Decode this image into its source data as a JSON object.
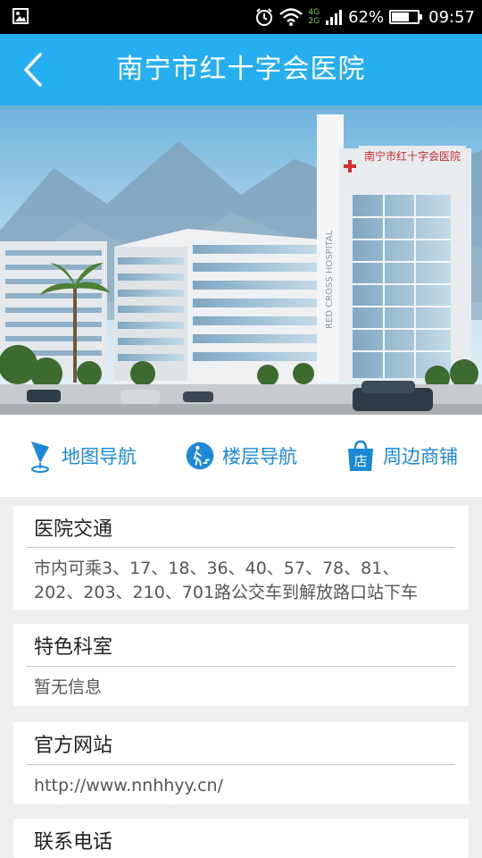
{
  "status_bar": {
    "network_top": "4G",
    "network_bottom": "2G",
    "battery": "62%",
    "battery_level": 0.62,
    "time": "09:57",
    "icons": [
      "image-icon",
      "alarm-icon",
      "wifi-icon",
      "signal-icon",
      "battery-icon"
    ]
  },
  "header": {
    "title": "南宁市红十字会医院",
    "back_icon": "chevron-left-icon",
    "color": "#25aef0"
  },
  "hero": {
    "sign_text": "南宁市红十字会医院",
    "vertical_text": "RED CROSS HOSPITAL"
  },
  "nav": {
    "items": [
      {
        "label": "地图导航",
        "icon": "map-pin-icon"
      },
      {
        "label": "楼层导航",
        "icon": "floor-walk-icon"
      },
      {
        "label": "周边商铺",
        "icon": "shop-bag-icon"
      }
    ],
    "accent": "#1a8ad8"
  },
  "sections": {
    "traffic": {
      "title": "医院交通",
      "line1": "市内可乘3、17、18、36、40、57、78、81、",
      "line2": "202、203、210、701路公交车到解放路口站下车"
    },
    "departments": {
      "title": "特色科室",
      "body": "暂无信息"
    },
    "website": {
      "title": "官方网站",
      "body": "http://www.nnhhyy.cn/"
    },
    "phone": {
      "title": "联系电话"
    }
  }
}
